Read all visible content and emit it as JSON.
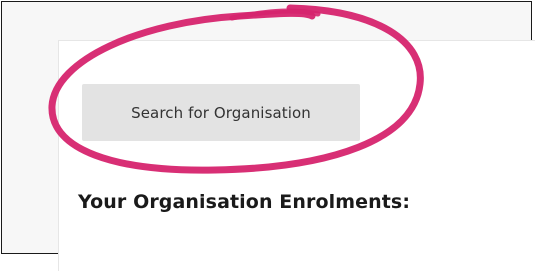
{
  "content": {
    "search_button_label": "Search for Organisation",
    "enrolments_heading": "Your Organisation Enrolments:"
  },
  "annotation": {
    "type": "hand-drawn-circle",
    "color": "#d6246e"
  }
}
